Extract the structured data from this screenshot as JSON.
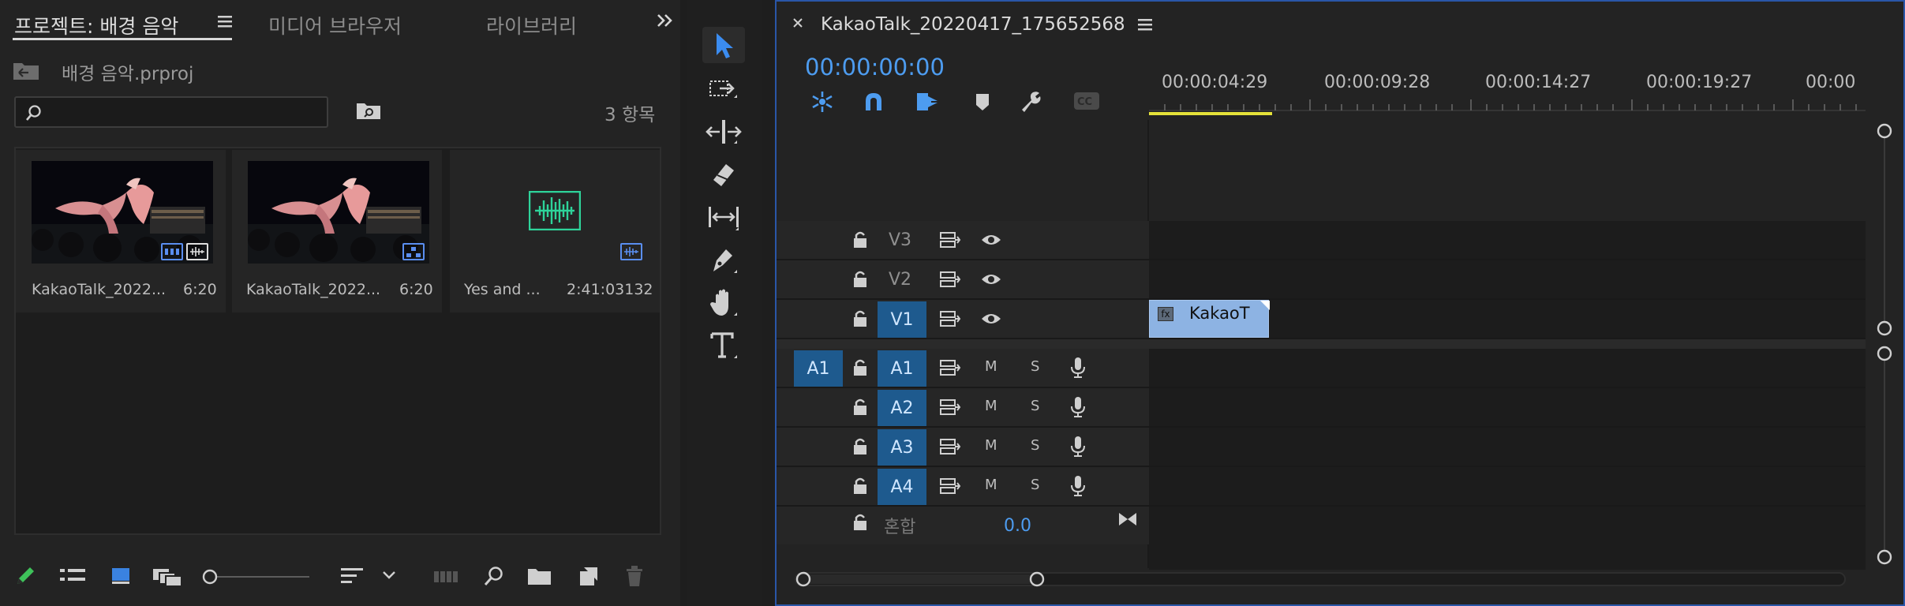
{
  "project_panel": {
    "tabs": [
      {
        "label": "프로젝트: 배경 음악",
        "active": true
      },
      {
        "label": "미디어 브라우저",
        "active": false
      },
      {
        "label": "라이브러리",
        "active": false
      }
    ],
    "overflow_icon": "double-chevron-right-icon",
    "project_file": "배경 음악.prproj",
    "search_placeholder": "",
    "item_count": "3 항목",
    "items": [
      {
        "name": "KakaoTalk_2022...",
        "duration": "6:20",
        "kind": "video-with-audio"
      },
      {
        "name": "KakaoTalk_2022...",
        "duration": "6:20",
        "kind": "sequence"
      },
      {
        "name": "Yes and ...",
        "duration": "2:41:03132",
        "kind": "audio"
      }
    ]
  },
  "tools": [
    "selection-tool",
    "track-select-tool",
    "ripple-edit-tool",
    "razor-tool",
    "slip-tool",
    "pen-tool",
    "hand-tool",
    "type-tool"
  ],
  "timeline": {
    "sequence_name": "KakaoTalk_20220417_175652568",
    "timecode": "00:00:00:00",
    "ruler_labels": [
      "00:00:04:29",
      "00:00:09:28",
      "00:00:14:27",
      "00:00:19:27",
      "00:00"
    ],
    "video_tracks": [
      {
        "name": "V3",
        "targeted": false
      },
      {
        "name": "V2",
        "targeted": false
      },
      {
        "name": "V1",
        "targeted": true
      }
    ],
    "audio_source": "A1",
    "audio_tracks": [
      {
        "name": "A1",
        "m": "M",
        "s": "S"
      },
      {
        "name": "A2",
        "m": "M",
        "s": "S"
      },
      {
        "name": "A3",
        "m": "M",
        "s": "S"
      },
      {
        "name": "A4",
        "m": "M",
        "s": "S"
      }
    ],
    "mix": {
      "label": "혼합",
      "value": "0.0"
    },
    "clip": {
      "label": "KakaoT",
      "fx": "fx"
    },
    "accent_color": "#4d9cf0",
    "work_area_color": "#e5e23a",
    "clip_color": "#8db3e3"
  }
}
